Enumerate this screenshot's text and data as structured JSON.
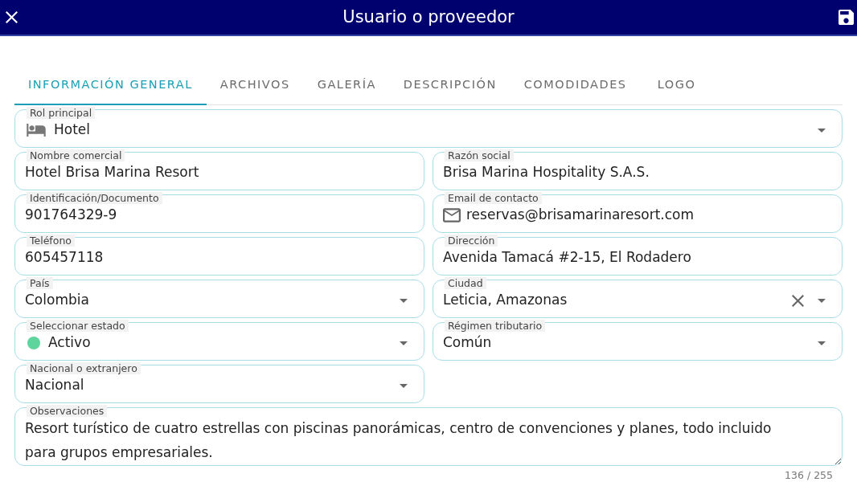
{
  "header": {
    "title": "Usuario o proveedor"
  },
  "tabs": [
    {
      "label": "INFORMACIÓN GENERAL",
      "selected": true
    },
    {
      "label": "ARCHIVOS",
      "selected": false
    },
    {
      "label": "GALERÍA",
      "selected": false
    },
    {
      "label": "DESCRIPCIÓN",
      "selected": false
    },
    {
      "label": "COMODIDADES",
      "selected": false
    },
    {
      "label": "LOGO",
      "selected": false
    }
  ],
  "fields": [
    {
      "kind": "role_select",
      "label": "Rol principal",
      "value": "Hotel",
      "wide": true
    },
    {
      "kind": "text",
      "label": "Nombre comercial",
      "value": "Hotel Brisa Marina Resort",
      "wide": false
    },
    {
      "kind": "text",
      "label": "Razón social",
      "value": "Brisa Marina Hospitality S.A.S.",
      "wide": false
    },
    {
      "kind": "text",
      "label": "Identificación/Documento",
      "value": "901764329-9",
      "wide": false
    },
    {
      "kind": "email",
      "label": "Email de contacto",
      "value": "reservas@brisamarinaresort.com",
      "wide": false
    },
    {
      "kind": "text",
      "label": "Teléfono",
      "value": "605457118",
      "wide": false
    },
    {
      "kind": "text",
      "label": "Dirección",
      "value": "Avenida Tamacá #2-15, El Rodadero",
      "wide": false
    },
    {
      "kind": "select",
      "label": "País",
      "value": "Colombia",
      "clearable": false,
      "wide": false
    },
    {
      "kind": "select",
      "label": "Ciudad",
      "value": "Leticia, Amazonas",
      "clearable": true,
      "wide": false
    },
    {
      "kind": "status_select",
      "label": "Seleccionar estado",
      "value": "Activo",
      "color": "#5fd49c",
      "wide": false
    },
    {
      "kind": "select",
      "label": "Régimen tributario",
      "value": "Común",
      "clearable": false,
      "wide": false
    },
    {
      "kind": "select",
      "label": "Nacional o extranjero",
      "value": "Nacional",
      "clearable": false,
      "wide": false
    },
    {
      "kind": "textarea",
      "label": "Observaciones",
      "value": "Resort turístico de cuatro estrellas con piscinas panorámicas, centro de convenciones y planes, todo incluido para grupos empresariales.",
      "counter": "136 / 255",
      "wide": true
    }
  ]
}
